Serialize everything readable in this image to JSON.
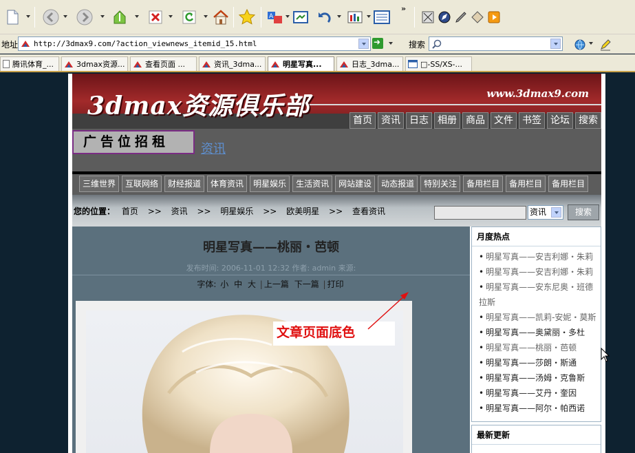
{
  "browser": {
    "address_label": "地址",
    "url": "http://3dmax9.com/?action_viewnews_itemid_15.html",
    "search_label": "搜索",
    "toolbar_overflow": "»",
    "tabs": [
      {
        "label": "腾讯体育_..."
      },
      {
        "label": "3dmax资源..."
      },
      {
        "label": "查看页面 ..."
      },
      {
        "label": "资讯_3dma..."
      },
      {
        "label": "明星写真...",
        "active": true
      },
      {
        "label": "日志_3dma..."
      },
      {
        "label": "□-SS/XS-..."
      }
    ]
  },
  "site": {
    "logo": "3dmax资源俱乐部",
    "url": "www.3dmax9.com",
    "nav": [
      "首页",
      "资讯",
      "日志",
      "相册",
      "商品",
      "文件",
      "书签",
      "论坛",
      "搜索"
    ],
    "ad_text": "广告位招租",
    "channel_title": "资讯",
    "subnav": [
      "三维世界",
      "互联网络",
      "财经报道",
      "体育资讯",
      "明星娱乐",
      "生活资讯",
      "网站建设",
      "动态报道",
      "特别关注",
      "备用栏目",
      "备用栏目",
      "备用栏目"
    ]
  },
  "location": {
    "label": "您的位置：",
    "crumbs": [
      "首页",
      "资讯",
      "明星娱乐",
      "欧美明星",
      "查看资讯"
    ],
    "separator": ">>",
    "select_value": "资讯",
    "search_button": "搜索"
  },
  "article": {
    "title": "明星写真——桃丽・芭顿",
    "meta": "发布时间: 2006-11-01 12:32   作者: admin   来源:",
    "tools_label": "字体:",
    "font_sizes": [
      "小",
      "中",
      "大"
    ],
    "prev": "上一篇",
    "next": "下一篇",
    "print": "打印"
  },
  "sidebar": {
    "hot_title": "月度热点",
    "hot_items": [
      {
        "text": "明星写真——安吉利娜・朱莉",
        "visited": true
      },
      {
        "text": "明星写真——安吉利娜・朱莉",
        "visited": true
      },
      {
        "text": "明星写真——安东尼奥・班德拉斯",
        "visited": true
      },
      {
        "text": "明星写真——凯莉-安妮・莫斯",
        "visited": true
      },
      {
        "text": "明星写真——奥黛丽・多杜",
        "visited": false
      },
      {
        "text": "明星写真——桃丽・芭顿",
        "visited": true
      },
      {
        "text": "明星写真——莎朗・斯通",
        "visited": false
      },
      {
        "text": "明星写真——汤姆・克鲁斯",
        "visited": false
      },
      {
        "text": "明星写真——艾丹・奎因",
        "visited": false
      },
      {
        "text": "明星写真——阿尔・帕西诺",
        "visited": false
      }
    ],
    "new_title": "最新更新"
  },
  "annotation": {
    "text": "文章页面底色",
    "color": "#e01010"
  },
  "colors": {
    "content_bg": "#5b707d",
    "banner": "#a22a2a",
    "nav_bg": "#5a5a5a"
  }
}
